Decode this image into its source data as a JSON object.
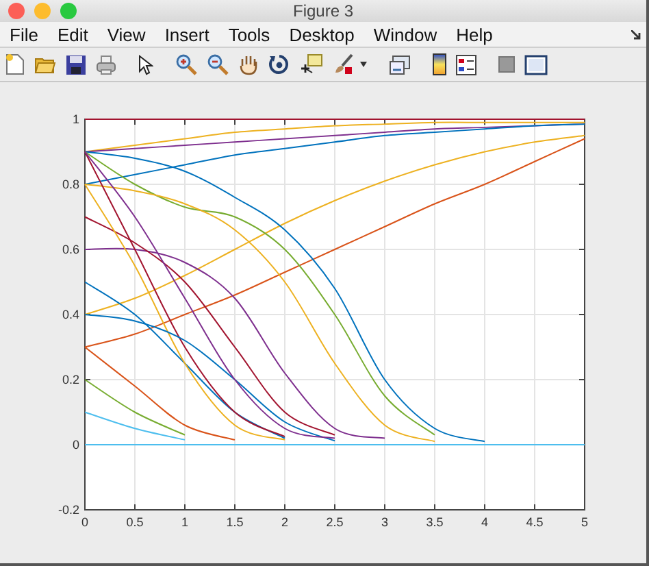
{
  "window": {
    "title": "Figure 3"
  },
  "menu": [
    "File",
    "Edit",
    "View",
    "Insert",
    "Tools",
    "Desktop",
    "Window",
    "Help"
  ],
  "axes": {
    "chart_data": {
      "type": "line",
      "x": [
        0,
        0.5,
        1,
        1.5,
        2,
        2.5,
        3,
        3.5,
        4,
        4.5,
        5
      ],
      "xlim": [
        0,
        5
      ],
      "ylim": [
        -0.2,
        1
      ],
      "grid": true,
      "xticks": [
        0,
        0.5,
        1,
        1.5,
        2,
        2.5,
        3,
        3.5,
        4,
        4.5,
        5
      ],
      "yticks": [
        -0.2,
        0,
        0.2,
        0.4,
        0.6,
        0.8,
        1
      ],
      "series": [
        {
          "color": "#a2142f",
          "values": [
            1,
            1,
            1,
            1,
            1,
            1,
            1,
            1,
            1,
            1,
            1
          ]
        },
        {
          "color": "#4dbeee",
          "values": [
            0,
            0,
            0,
            0,
            0,
            0,
            0,
            0,
            0,
            0,
            0
          ]
        },
        {
          "color": "#edb120",
          "values": [
            0.9,
            0.92,
            0.94,
            0.96,
            0.97,
            0.98,
            0.985,
            0.99,
            0.99,
            0.99,
            0.99
          ]
        },
        {
          "color": "#7e2f8e",
          "values": [
            0.9,
            0.91,
            0.92,
            0.93,
            0.94,
            0.95,
            0.96,
            0.97,
            0.975,
            0.98,
            0.985
          ]
        },
        {
          "color": "#0072bd",
          "values": [
            0.8,
            0.83,
            0.86,
            0.89,
            0.91,
            0.93,
            0.95,
            0.96,
            0.97,
            0.98,
            0.985
          ]
        },
        {
          "color": "#d95319",
          "values": [
            0.3,
            0.34,
            0.4,
            0.46,
            0.53,
            0.6,
            0.67,
            0.74,
            0.8,
            0.87,
            0.94
          ]
        },
        {
          "color": "#edb120",
          "values": [
            0.4,
            0.45,
            0.52,
            0.6,
            0.68,
            0.75,
            0.81,
            0.86,
            0.9,
            0.93,
            0.95
          ]
        },
        {
          "color": "#0072bd",
          "values": [
            0.9,
            0.88,
            0.84,
            0.76,
            0.66,
            0.48,
            0.2,
            0.05,
            0.01,
            null,
            null
          ]
        },
        {
          "color": "#77ac30",
          "values": [
            0.9,
            0.8,
            0.73,
            0.7,
            0.6,
            0.4,
            0.15,
            0.03,
            null,
            null,
            null
          ]
        },
        {
          "color": "#edb120",
          "values": [
            0.8,
            0.78,
            0.74,
            0.66,
            0.5,
            0.25,
            0.06,
            0.01,
            null,
            null,
            null
          ]
        },
        {
          "color": "#7e2f8e",
          "values": [
            0.6,
            0.6,
            0.56,
            0.45,
            0.22,
            0.05,
            0.02,
            null,
            null,
            null,
            null
          ]
        },
        {
          "color": "#a2142f",
          "values": [
            0.7,
            0.62,
            0.5,
            0.3,
            0.1,
            0.03,
            null,
            null,
            null,
            null,
            null
          ]
        },
        {
          "color": "#0072bd",
          "values": [
            0.5,
            0.4,
            0.25,
            0.1,
            0.02,
            null,
            null,
            null,
            null,
            null,
            null
          ]
        },
        {
          "color": "#d95319",
          "values": [
            0.3,
            0.18,
            0.06,
            0.015,
            null,
            null,
            null,
            null,
            null,
            null,
            null
          ]
        },
        {
          "color": "#77ac30",
          "values": [
            0.2,
            0.1,
            0.03,
            null,
            null,
            null,
            null,
            null,
            null,
            null,
            null
          ]
        },
        {
          "color": "#4dbeee",
          "values": [
            0.1,
            0.05,
            0.015,
            null,
            null,
            null,
            null,
            null,
            null,
            null,
            null
          ]
        },
        {
          "color": "#edb120",
          "values": [
            0.8,
            0.55,
            0.25,
            0.06,
            0.015,
            null,
            null,
            null,
            null,
            null,
            null
          ]
        },
        {
          "color": "#a2142f",
          "values": [
            0.9,
            0.6,
            0.3,
            0.1,
            0.025,
            null,
            null,
            null,
            null,
            null,
            null
          ]
        },
        {
          "color": "#0072bd",
          "values": [
            0.4,
            0.38,
            0.32,
            0.2,
            0.07,
            0.012,
            null,
            null,
            null,
            null,
            null
          ]
        },
        {
          "color": "#7e2f8e",
          "values": [
            0.9,
            0.7,
            0.45,
            0.2,
            0.05,
            0.02,
            null,
            null,
            null,
            null,
            null
          ]
        }
      ]
    }
  }
}
